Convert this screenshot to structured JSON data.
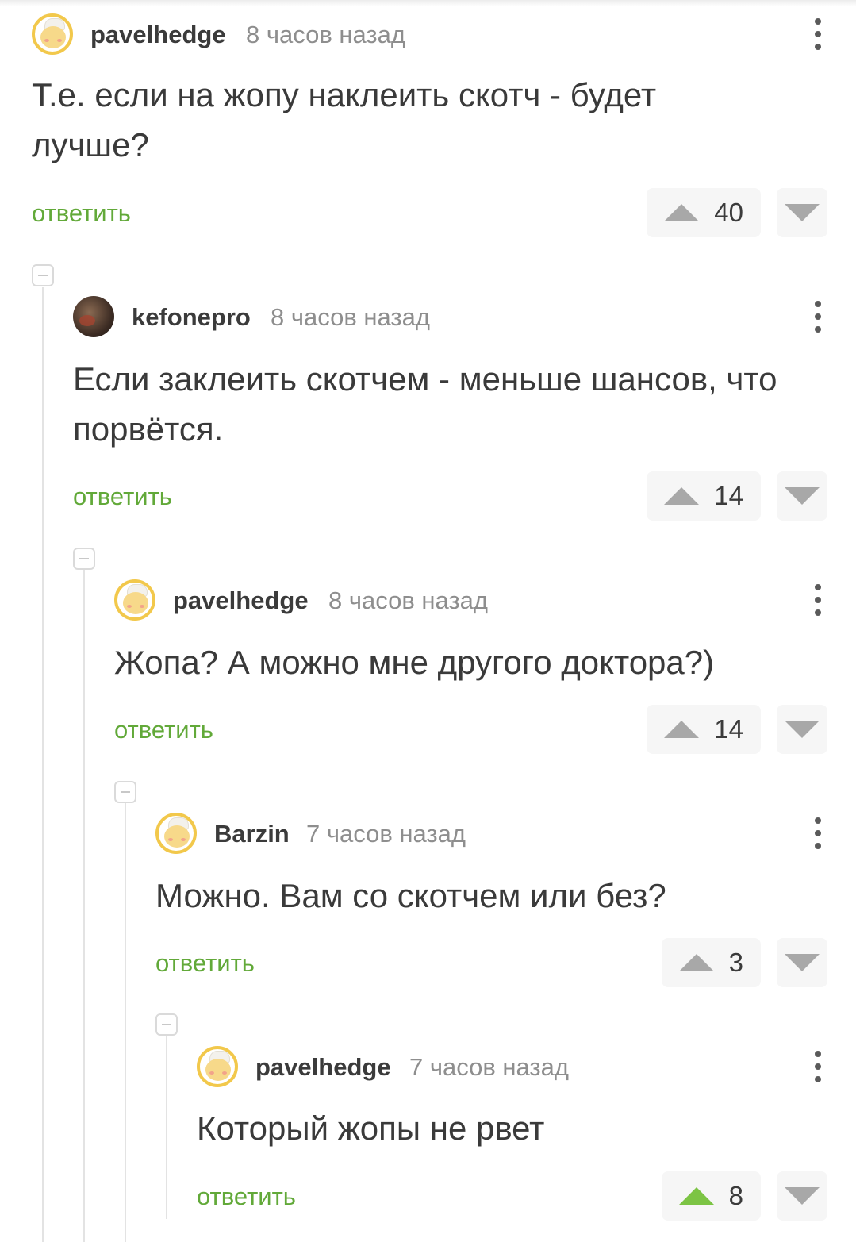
{
  "comments": [
    {
      "username": "pavelhedge",
      "time": "8 часов назад",
      "avatar": "bun-avatar-icon",
      "text": "Т.е. если на жопу наклеить скотч - будет лучше?",
      "reply_label": "ответить",
      "score": "40",
      "upvoted": false
    },
    {
      "username": "kefonepro",
      "time": "8 часов назад",
      "avatar": "photo-avatar",
      "text": "Если заклеить скотчем - меньше шансов, что порвётся.",
      "reply_label": "ответить",
      "score": "14",
      "upvoted": false
    },
    {
      "username": "pavelhedge",
      "time": "8 часов назад",
      "avatar": "bun-avatar-icon",
      "text": "Жопа? А можно мне другого доктора?)",
      "reply_label": "ответить",
      "score": "14",
      "upvoted": false
    },
    {
      "username": "Barzin",
      "time": "7 часов назад",
      "avatar": "bun-avatar-icon",
      "text": "Можно. Вам со скотчем или без?",
      "reply_label": "ответить",
      "score": "3",
      "upvoted": false
    },
    {
      "username": "pavelhedge",
      "time": "7 часов назад",
      "avatar": "bun-avatar-icon",
      "text": "Который жопы не рвет",
      "reply_label": "ответить",
      "score": "8",
      "upvoted": true
    }
  ],
  "colors": {
    "accent_green": "#62a939",
    "upvote_active": "#7cc444",
    "vote_arrow": "#a8a8a8"
  }
}
